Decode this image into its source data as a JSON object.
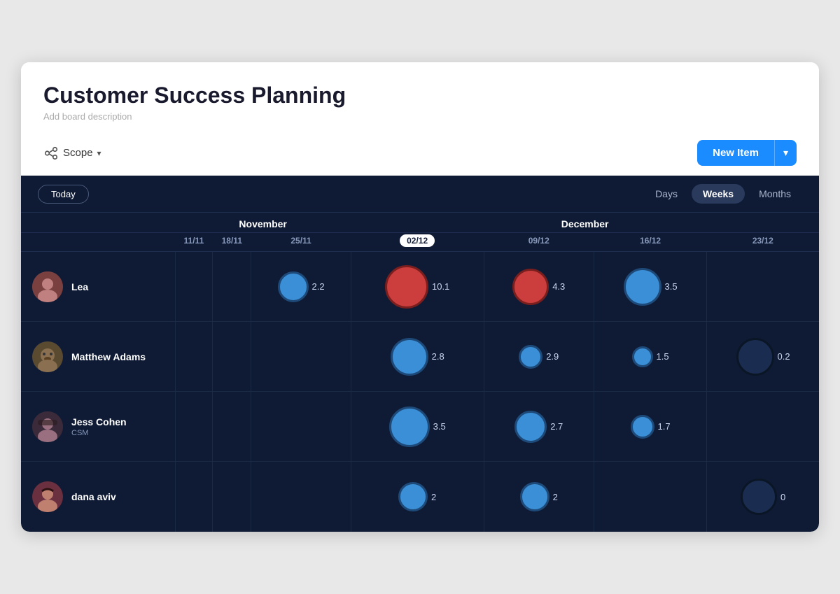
{
  "header": {
    "title": "Customer Success Planning",
    "description": "Add board description"
  },
  "toolbar": {
    "scope_label": "Scope",
    "new_item_label": "New Item"
  },
  "gantt": {
    "today_label": "Today",
    "view_options": [
      "Days",
      "Weeks",
      "Months"
    ],
    "active_view": "Weeks",
    "months": [
      {
        "label": "November",
        "colspan": 3
      },
      {
        "label": "December",
        "colspan": 5
      }
    ],
    "dates": [
      {
        "label": "11/11",
        "highlight": false
      },
      {
        "label": "18/11",
        "highlight": false
      },
      {
        "label": "25/11",
        "highlight": false
      },
      {
        "label": "02/12",
        "highlight": true
      },
      {
        "label": "09/12",
        "highlight": false
      },
      {
        "label": "16/12",
        "highlight": false
      },
      {
        "label": "23/12",
        "highlight": false
      }
    ],
    "people": [
      {
        "name": "Lea",
        "role": "",
        "avatar_emoji": "👩",
        "data": [
          null,
          null,
          {
            "size": "md",
            "color": "blue",
            "value": "2.2"
          },
          {
            "size": "lg",
            "color": "red",
            "value": "10.1"
          },
          {
            "size": "md",
            "color": "red",
            "value": "4.3"
          },
          {
            "size": "lg",
            "color": "blue",
            "value": "3.5"
          },
          null
        ]
      },
      {
        "name": "Matthew Adams",
        "role": "",
        "avatar_emoji": "🐶",
        "data": [
          null,
          null,
          null,
          {
            "size": "md",
            "color": "blue",
            "value": "2.8"
          },
          {
            "size": "sm",
            "color": "blue",
            "value": "2.9"
          },
          {
            "size": "sm",
            "color": "blue",
            "value": "1.5"
          },
          {
            "size": "lg",
            "color": "dark",
            "value": "0.2"
          }
        ]
      },
      {
        "name": "Jess Cohen",
        "role": "CSM",
        "avatar_emoji": "👩",
        "data": [
          null,
          null,
          null,
          {
            "size": "lg",
            "color": "blue",
            "value": "3.5"
          },
          {
            "size": "md",
            "color": "blue",
            "value": "2.7"
          },
          {
            "size": "sm",
            "color": "blue",
            "value": "1.7"
          },
          null
        ]
      },
      {
        "name": "dana aviv",
        "role": "",
        "avatar_emoji": "👩",
        "data": [
          null,
          null,
          null,
          {
            "size": "md",
            "color": "blue",
            "value": "2"
          },
          {
            "size": "md",
            "color": "blue",
            "value": "2"
          },
          null,
          {
            "size": "lg",
            "color": "dark",
            "value": "0"
          }
        ]
      }
    ]
  }
}
